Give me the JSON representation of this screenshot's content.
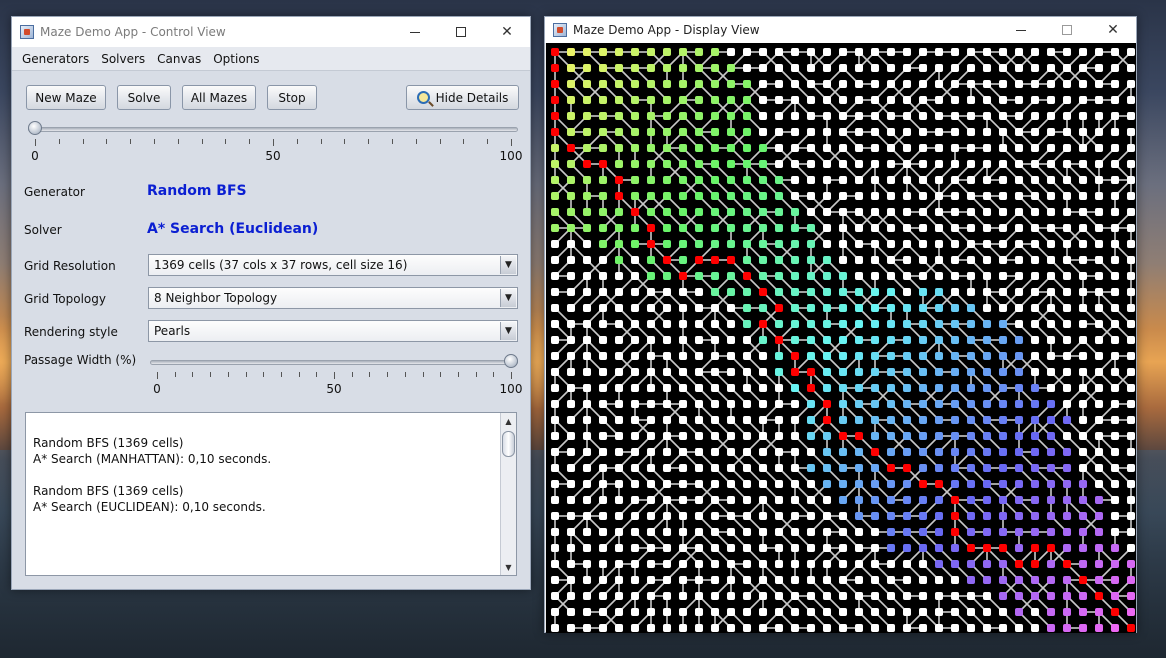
{
  "control_window": {
    "title": "Maze Demo App - Control View",
    "menus": [
      "Generators",
      "Solvers",
      "Canvas",
      "Options"
    ],
    "buttons": {
      "new_maze": "New Maze",
      "solve": "Solve",
      "all_mazes": "All Mazes",
      "stop": "Stop",
      "hide_details": "Hide Details"
    },
    "delay_slider": {
      "value": 0,
      "min_label": "0",
      "mid_label": "50",
      "max_label": "100"
    },
    "generator": {
      "label": "Generator",
      "value": "Random BFS"
    },
    "solver": {
      "label": "Solver",
      "value": "A* Search (Euclidean)"
    },
    "grid_resolution": {
      "label": "Grid Resolution",
      "value": "1369 cells (37 cols x 37 rows, cell size 16)"
    },
    "grid_topology": {
      "label": "Grid Topology",
      "value": "8 Neighbor Topology"
    },
    "rendering_style": {
      "label": "Rendering style",
      "value": "Pearls"
    },
    "passage_width": {
      "label": "Passage Width (%)",
      "value": 100,
      "min_label": "0",
      "mid_label": "50",
      "max_label": "100"
    },
    "log": [
      "Random BFS (1369 cells)",
      "A* Search (MANHATTAN): 0,10 seconds.",
      "",
      "Random BFS (1369 cells)",
      "A* Search (EUCLIDEAN): 0,10 seconds."
    ]
  },
  "display_window": {
    "title": "Maze Demo App - Display View",
    "cols": 37,
    "rows": 37,
    "colors": {
      "background": "#000000",
      "pearl": "#ffffff",
      "passage": "#c8c8c8",
      "solution_path": "#ff0000"
    },
    "icons": {
      "app": "java-app-icon",
      "minimize": "minimize-icon",
      "maximize": "maximize-icon",
      "close": "close-icon",
      "hide_details": "magnifier-icon"
    }
  }
}
